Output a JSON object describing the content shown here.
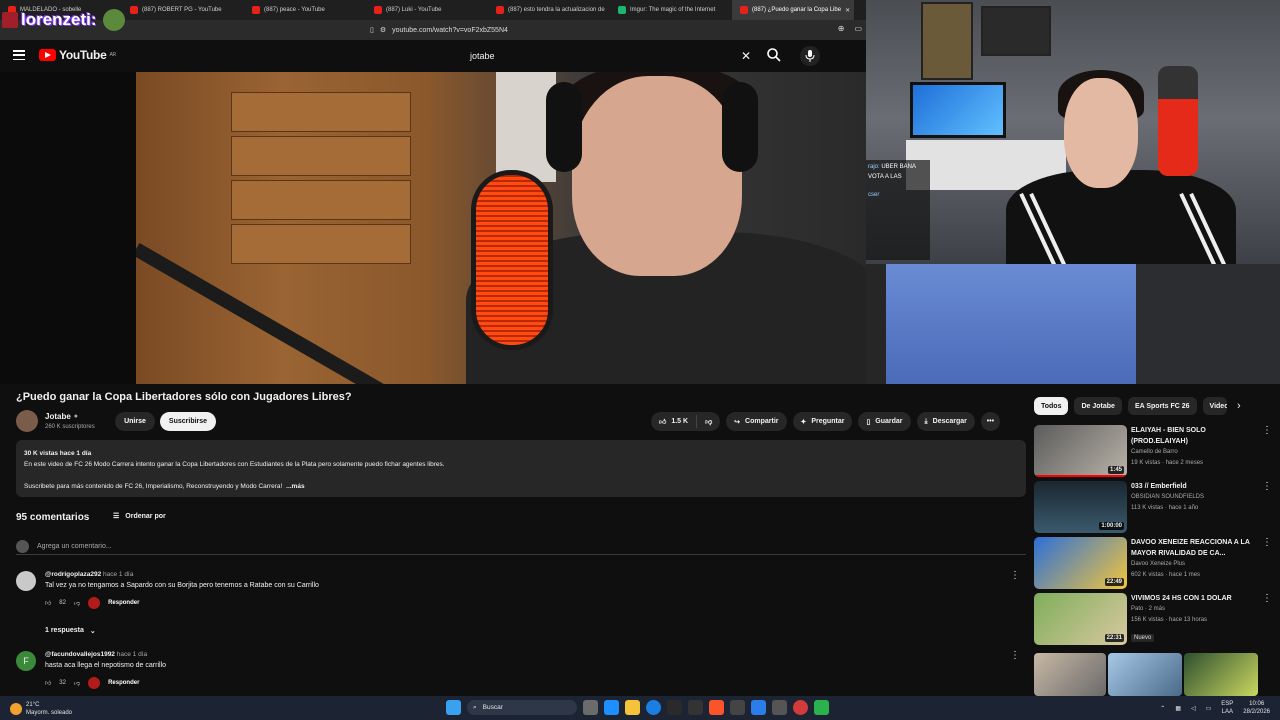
{
  "browser": {
    "tabs": [
      {
        "label": "MALDELADO - sobelle"
      },
      {
        "label": "(887) ROBERT PG - YouTube"
      },
      {
        "label": "(887) peace - YouTube"
      },
      {
        "label": "(887) Luki - YouTube"
      },
      {
        "label": "(887) esto tendra la actualizacion de"
      },
      {
        "label": "Imgur: The magic of the Internet"
      },
      {
        "label": "(887) ¿Puedo ganar la Copa Libe"
      }
    ],
    "url": "youtube.com/watch?v=voF2xbZ55N4"
  },
  "overlay": {
    "streamer_name": "lorenzeti:",
    "chat_lines": [
      {
        "name": "rajo:",
        "text": "UBER BANA"
      },
      {
        "name": "",
        "text": "VOTA A LAS"
      },
      {
        "name": "cser",
        "text": ""
      }
    ]
  },
  "masthead": {
    "logo": "YouTube",
    "country": "AR",
    "search_value": "jotabe"
  },
  "video": {
    "title": "¿Puedo ganar la Copa Libertadores sólo con Jugadores Libres?",
    "channel": "Jotabe",
    "subscribers": "260 K suscriptores",
    "join_label": "Unirse",
    "subscribe_label": "Suscribirse",
    "likes": "1.5 K",
    "share_label": "Compartir",
    "ask_label": "Preguntar",
    "save_label": "Guardar",
    "download_label": "Descargar"
  },
  "description": {
    "stats": "30 K vistas  hace 1 día",
    "line1": "En este video de FC 26 Modo Carrera intento ganar la Copa Libertadores con Estudiantes de la Plata pero solamente puedo fichar agentes libres.",
    "line2": "Suscribete para más contenido de FC 26, Imperialismo, Reconstruyendo y Modo Carrera!",
    "more": "...más"
  },
  "comments": {
    "count": "95 comentarios",
    "sort_label": "Ordenar por",
    "add_placeholder": "Agrega un comentario...",
    "items": [
      {
        "author": "@rodrigoplaza292",
        "time": "hace 1 día",
        "text": "Tal vez ya no tengamos a Sapardo con su Borjita pero tenemos a Ratabe con su Carrillo",
        "likes": "82",
        "reply": "Responder",
        "initial": ""
      },
      {
        "author": "@facundovallejos1992",
        "time": "hace 1 día",
        "text": "hasta aca llega el nepotismo de carrillo",
        "likes": "32",
        "reply": "Responder",
        "initial": "F"
      }
    ],
    "replies_label": "1 respuesta"
  },
  "sidebar": {
    "chips": [
      "Todos",
      "De Jotabe",
      "EA Sports FC 26",
      "Video"
    ],
    "recs": [
      {
        "title": "ELAIYAH - BIEN SOLO (PROD.ELAIYAH)",
        "channel": "Camello de Barro",
        "meta": "19 K vistas · hace 2 meses",
        "duration": "1:45",
        "badge": ""
      },
      {
        "title": "033 // Emberfield",
        "channel": "OBSIDIAN SOUNDFIELDS",
        "meta": "113 K vistas · hace 1 año",
        "duration": "1:00:00",
        "badge": ""
      },
      {
        "title": "DAVOO XENEIZE REACCIONA A LA MAYOR RIVALIDAD DE CA...",
        "channel": "Davoo Xeneize Plus",
        "meta": "602 K vistas · hace 1 mes",
        "duration": "22:49",
        "badge": ""
      },
      {
        "title": "VIVIMOS 24 HS CON 1 DOLAR",
        "channel": "Pato · 2 más",
        "meta": "156 K vistas · hace 13 horas",
        "duration": "22:31",
        "badge": "Nuevo"
      },
      {
        "title": "",
        "channel": "",
        "meta": "",
        "duration": "",
        "badge": ""
      }
    ]
  },
  "taskbar": {
    "temperature": "21°C",
    "weather": "Mayorm. soleado",
    "search_label": "Buscar",
    "lang_top": "ESP",
    "lang_bottom": "LAA",
    "time": "10:06",
    "date": "28/2/2026"
  },
  "colors": {
    "accent_red": "#ff0000",
    "background": "#0f0f0f",
    "surface": "#272727"
  }
}
